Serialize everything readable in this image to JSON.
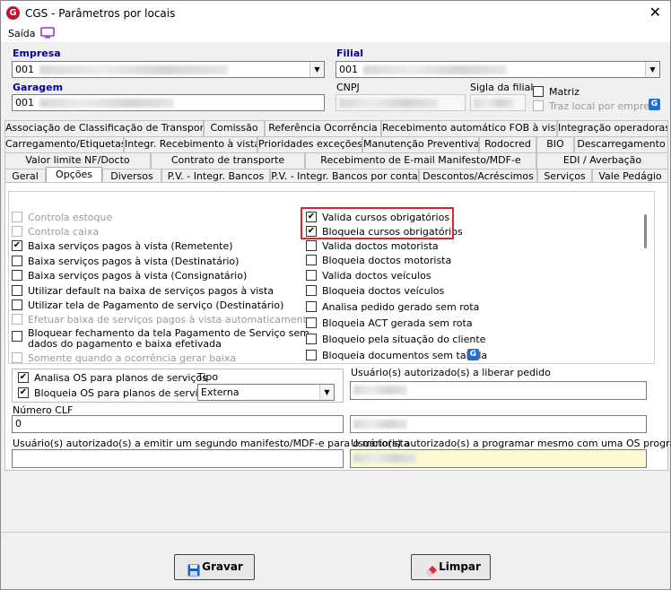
{
  "window": {
    "title": "CGS - Parâmetros por locais",
    "close_glyph": "✕",
    "logo_letter": "G"
  },
  "menu": {
    "saida": "Saída"
  },
  "empresa": {
    "label": "Empresa",
    "value": "001"
  },
  "filial": {
    "label": "Filial",
    "value": "001"
  },
  "garagem": {
    "label": "Garagem",
    "value": "001"
  },
  "cnpj": {
    "label": "CNPJ"
  },
  "sigla": {
    "label": "Sigla da filial"
  },
  "matriz": {
    "label": "Matriz",
    "checked": false
  },
  "traz_local": {
    "label": "Traz local por empresa",
    "checked": false
  },
  "tabs": {
    "row1": [
      "Associação de Classificação de Transporte",
      "Comissão",
      "Referência Ocorrência",
      "Recebimento automático FOB à vista",
      "Integração operadoras"
    ],
    "row2": [
      "Carregamento/Etiquetas",
      "Integr. Recebimento à vista",
      "Prioridades exceções",
      "Manutenção Preventiva",
      "Rodocred",
      "BIO",
      "Descarregamento"
    ],
    "row3": [
      "Valor limite NF/Docto",
      "Contrato de transporte",
      "Recebimento de E-mail Manifesto/MDF-e",
      "EDI / Averbação"
    ],
    "row4": [
      "Geral",
      "Opções",
      "Diversos",
      "P.V. - Integr. Bancos",
      "P.V. - Integr. Bancos por conta",
      "Descontos/Acréscimos",
      "Serviços",
      "Vale Pedágio"
    ]
  },
  "left_options": [
    {
      "label": "Controla estoque",
      "checked": false,
      "disabled": true
    },
    {
      "label": "Controla caixa",
      "checked": false,
      "disabled": true
    },
    {
      "label": "Baixa serviços pagos à vista (Remetente)",
      "checked": true,
      "disabled": false
    },
    {
      "label": "Baixa serviços pagos à vista (Destinatário)",
      "checked": false,
      "disabled": false
    },
    {
      "label": "Baixa serviços pagos à vista (Consignatário)",
      "checked": false,
      "disabled": false
    },
    {
      "label": "Utilizar default na baixa de serviços pagos à vista",
      "checked": false,
      "disabled": false
    },
    {
      "label": "Utilizar tela de Pagamento de serviço (Destinatário)",
      "checked": false,
      "disabled": false
    },
    {
      "label": "Efetuar baixa de serviços pagos à vista automaticamente",
      "checked": false,
      "disabled": true
    },
    {
      "label": "Bloquear fechamento da tela Pagamento de Serviço sem",
      "label2": "dados do pagamento e baixa efetivada",
      "checked": false,
      "disabled": false
    },
    {
      "label": "Somente quando a ocorrência gerar baixa",
      "checked": false,
      "disabled": true
    }
  ],
  "right_options": [
    {
      "label": "Valida cursos obrigatórios",
      "checked": true
    },
    {
      "label": "Bloqueia cursos obrigatórios",
      "checked": true
    },
    {
      "label": "Valida doctos motorista",
      "checked": false
    },
    {
      "label": "Bloqueia doctos motorista",
      "checked": false
    },
    {
      "label": "Valida doctos veículos",
      "checked": false
    },
    {
      "label": "Bloqueia doctos veículos",
      "checked": false
    },
    {
      "label": "Analisa pedido gerado sem rota",
      "checked": false
    },
    {
      "label": "Bloqueia ACT gerada sem rota",
      "checked": false
    },
    {
      "label": "Bloqueio pela situação do cliente",
      "checked": false
    },
    {
      "label": "Bloqueia documentos sem tabela",
      "checked": false
    }
  ],
  "os_group": {
    "analisa": {
      "label": "Analisa OS para planos de serviços",
      "checked": true
    },
    "bloqueia": {
      "label": "Bloqueia OS para planos de serviços",
      "checked": true
    },
    "tipo_label": "Tipo",
    "tipo_value": "Externa"
  },
  "usuarios_liberar": {
    "label": "Usuário(s) autorizado(s) a liberar pedido"
  },
  "numero_clf": {
    "label": "Número CLF",
    "value": "0"
  },
  "segundo_manifesto": {
    "label": "Usuário(s) autorizado(s) a emitir um segundo manifesto/MDF-e para o motorista"
  },
  "programar_os": {
    "label": "Usuário(s) autorizado(s) a programar mesmo com uma OS programada"
  },
  "buttons": {
    "gravar": "Gravar",
    "limpar": "Limpar"
  },
  "colors": {
    "section_label": "#00009c",
    "highlight_box": "#d9262c",
    "yellow_field": "#fafad2"
  }
}
